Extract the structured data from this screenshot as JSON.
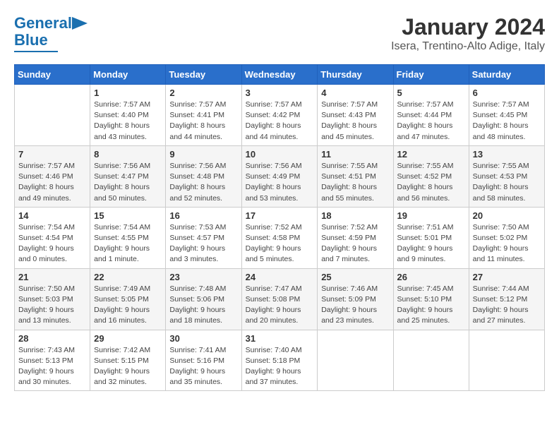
{
  "logo": {
    "line1": "General",
    "line2": "Blue"
  },
  "title": "January 2024",
  "subtitle": "Isera, Trentino-Alto Adige, Italy",
  "headers": [
    "Sunday",
    "Monday",
    "Tuesday",
    "Wednesday",
    "Thursday",
    "Friday",
    "Saturday"
  ],
  "weeks": [
    [
      {
        "num": "",
        "sunrise": "",
        "sunset": "",
        "daylight": ""
      },
      {
        "num": "1",
        "sunrise": "Sunrise: 7:57 AM",
        "sunset": "Sunset: 4:40 PM",
        "daylight": "Daylight: 8 hours and 43 minutes."
      },
      {
        "num": "2",
        "sunrise": "Sunrise: 7:57 AM",
        "sunset": "Sunset: 4:41 PM",
        "daylight": "Daylight: 8 hours and 44 minutes."
      },
      {
        "num": "3",
        "sunrise": "Sunrise: 7:57 AM",
        "sunset": "Sunset: 4:42 PM",
        "daylight": "Daylight: 8 hours and 44 minutes."
      },
      {
        "num": "4",
        "sunrise": "Sunrise: 7:57 AM",
        "sunset": "Sunset: 4:43 PM",
        "daylight": "Daylight: 8 hours and 45 minutes."
      },
      {
        "num": "5",
        "sunrise": "Sunrise: 7:57 AM",
        "sunset": "Sunset: 4:44 PM",
        "daylight": "Daylight: 8 hours and 47 minutes."
      },
      {
        "num": "6",
        "sunrise": "Sunrise: 7:57 AM",
        "sunset": "Sunset: 4:45 PM",
        "daylight": "Daylight: 8 hours and 48 minutes."
      }
    ],
    [
      {
        "num": "7",
        "sunrise": "Sunrise: 7:57 AM",
        "sunset": "Sunset: 4:46 PM",
        "daylight": "Daylight: 8 hours and 49 minutes."
      },
      {
        "num": "8",
        "sunrise": "Sunrise: 7:56 AM",
        "sunset": "Sunset: 4:47 PM",
        "daylight": "Daylight: 8 hours and 50 minutes."
      },
      {
        "num": "9",
        "sunrise": "Sunrise: 7:56 AM",
        "sunset": "Sunset: 4:48 PM",
        "daylight": "Daylight: 8 hours and 52 minutes."
      },
      {
        "num": "10",
        "sunrise": "Sunrise: 7:56 AM",
        "sunset": "Sunset: 4:49 PM",
        "daylight": "Daylight: 8 hours and 53 minutes."
      },
      {
        "num": "11",
        "sunrise": "Sunrise: 7:55 AM",
        "sunset": "Sunset: 4:51 PM",
        "daylight": "Daylight: 8 hours and 55 minutes."
      },
      {
        "num": "12",
        "sunrise": "Sunrise: 7:55 AM",
        "sunset": "Sunset: 4:52 PM",
        "daylight": "Daylight: 8 hours and 56 minutes."
      },
      {
        "num": "13",
        "sunrise": "Sunrise: 7:55 AM",
        "sunset": "Sunset: 4:53 PM",
        "daylight": "Daylight: 8 hours and 58 minutes."
      }
    ],
    [
      {
        "num": "14",
        "sunrise": "Sunrise: 7:54 AM",
        "sunset": "Sunset: 4:54 PM",
        "daylight": "Daylight: 9 hours and 0 minutes."
      },
      {
        "num": "15",
        "sunrise": "Sunrise: 7:54 AM",
        "sunset": "Sunset: 4:55 PM",
        "daylight": "Daylight: 9 hours and 1 minute."
      },
      {
        "num": "16",
        "sunrise": "Sunrise: 7:53 AM",
        "sunset": "Sunset: 4:57 PM",
        "daylight": "Daylight: 9 hours and 3 minutes."
      },
      {
        "num": "17",
        "sunrise": "Sunrise: 7:52 AM",
        "sunset": "Sunset: 4:58 PM",
        "daylight": "Daylight: 9 hours and 5 minutes."
      },
      {
        "num": "18",
        "sunrise": "Sunrise: 7:52 AM",
        "sunset": "Sunset: 4:59 PM",
        "daylight": "Daylight: 9 hours and 7 minutes."
      },
      {
        "num": "19",
        "sunrise": "Sunrise: 7:51 AM",
        "sunset": "Sunset: 5:01 PM",
        "daylight": "Daylight: 9 hours and 9 minutes."
      },
      {
        "num": "20",
        "sunrise": "Sunrise: 7:50 AM",
        "sunset": "Sunset: 5:02 PM",
        "daylight": "Daylight: 9 hours and 11 minutes."
      }
    ],
    [
      {
        "num": "21",
        "sunrise": "Sunrise: 7:50 AM",
        "sunset": "Sunset: 5:03 PM",
        "daylight": "Daylight: 9 hours and 13 minutes."
      },
      {
        "num": "22",
        "sunrise": "Sunrise: 7:49 AM",
        "sunset": "Sunset: 5:05 PM",
        "daylight": "Daylight: 9 hours and 16 minutes."
      },
      {
        "num": "23",
        "sunrise": "Sunrise: 7:48 AM",
        "sunset": "Sunset: 5:06 PM",
        "daylight": "Daylight: 9 hours and 18 minutes."
      },
      {
        "num": "24",
        "sunrise": "Sunrise: 7:47 AM",
        "sunset": "Sunset: 5:08 PM",
        "daylight": "Daylight: 9 hours and 20 minutes."
      },
      {
        "num": "25",
        "sunrise": "Sunrise: 7:46 AM",
        "sunset": "Sunset: 5:09 PM",
        "daylight": "Daylight: 9 hours and 23 minutes."
      },
      {
        "num": "26",
        "sunrise": "Sunrise: 7:45 AM",
        "sunset": "Sunset: 5:10 PM",
        "daylight": "Daylight: 9 hours and 25 minutes."
      },
      {
        "num": "27",
        "sunrise": "Sunrise: 7:44 AM",
        "sunset": "Sunset: 5:12 PM",
        "daylight": "Daylight: 9 hours and 27 minutes."
      }
    ],
    [
      {
        "num": "28",
        "sunrise": "Sunrise: 7:43 AM",
        "sunset": "Sunset: 5:13 PM",
        "daylight": "Daylight: 9 hours and 30 minutes."
      },
      {
        "num": "29",
        "sunrise": "Sunrise: 7:42 AM",
        "sunset": "Sunset: 5:15 PM",
        "daylight": "Daylight: 9 hours and 32 minutes."
      },
      {
        "num": "30",
        "sunrise": "Sunrise: 7:41 AM",
        "sunset": "Sunset: 5:16 PM",
        "daylight": "Daylight: 9 hours and 35 minutes."
      },
      {
        "num": "31",
        "sunrise": "Sunrise: 7:40 AM",
        "sunset": "Sunset: 5:18 PM",
        "daylight": "Daylight: 9 hours and 37 minutes."
      },
      {
        "num": "",
        "sunrise": "",
        "sunset": "",
        "daylight": ""
      },
      {
        "num": "",
        "sunrise": "",
        "sunset": "",
        "daylight": ""
      },
      {
        "num": "",
        "sunrise": "",
        "sunset": "",
        "daylight": ""
      }
    ]
  ]
}
